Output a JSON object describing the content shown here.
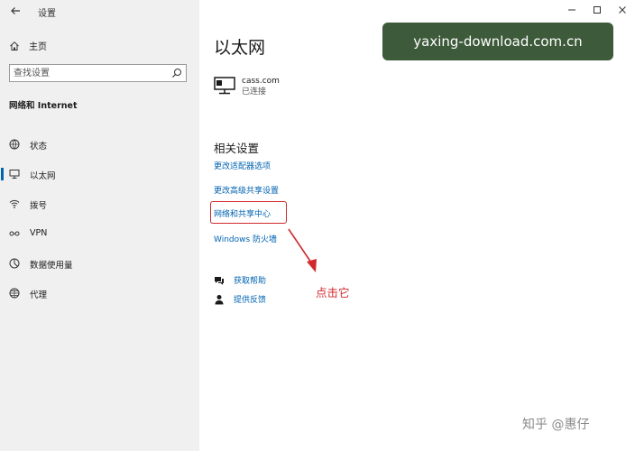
{
  "window": {
    "title": "设置"
  },
  "sidebar": {
    "home_label": "主页",
    "search_placeholder": "查找设置",
    "section_heading": "网络和 Internet",
    "items": [
      {
        "label": "状态",
        "icon": "globe-status-icon"
      },
      {
        "label": "以太网",
        "icon": "ethernet-icon",
        "selected": true
      },
      {
        "label": "拨号",
        "icon": "dialup-icon"
      },
      {
        "label": "VPN",
        "icon": "vpn-icon"
      },
      {
        "label": "数据使用量",
        "icon": "data-usage-icon"
      },
      {
        "label": "代理",
        "icon": "proxy-globe-icon"
      }
    ]
  },
  "main": {
    "title": "以太网",
    "network": {
      "name": "cass.com",
      "status": "已连接"
    },
    "related_heading": "相关设置",
    "links": [
      "更改适配器选项",
      "更改高级共享设置",
      "网络和共享中心",
      "Windows 防火墙"
    ],
    "help": [
      {
        "label": "获取帮助",
        "icon": "help-chat-icon"
      },
      {
        "label": "提供反馈",
        "icon": "feedback-person-icon"
      }
    ]
  },
  "watermark": "yaxing-download.com.cn",
  "annotation": {
    "text": "点击它",
    "color": "#d0282c"
  },
  "credit": "知乎 @惠仔",
  "colors": {
    "accent": "#0063b1",
    "sidebar_bg": "#f0f0f0",
    "watermark_bg": "#3d5a3a"
  }
}
